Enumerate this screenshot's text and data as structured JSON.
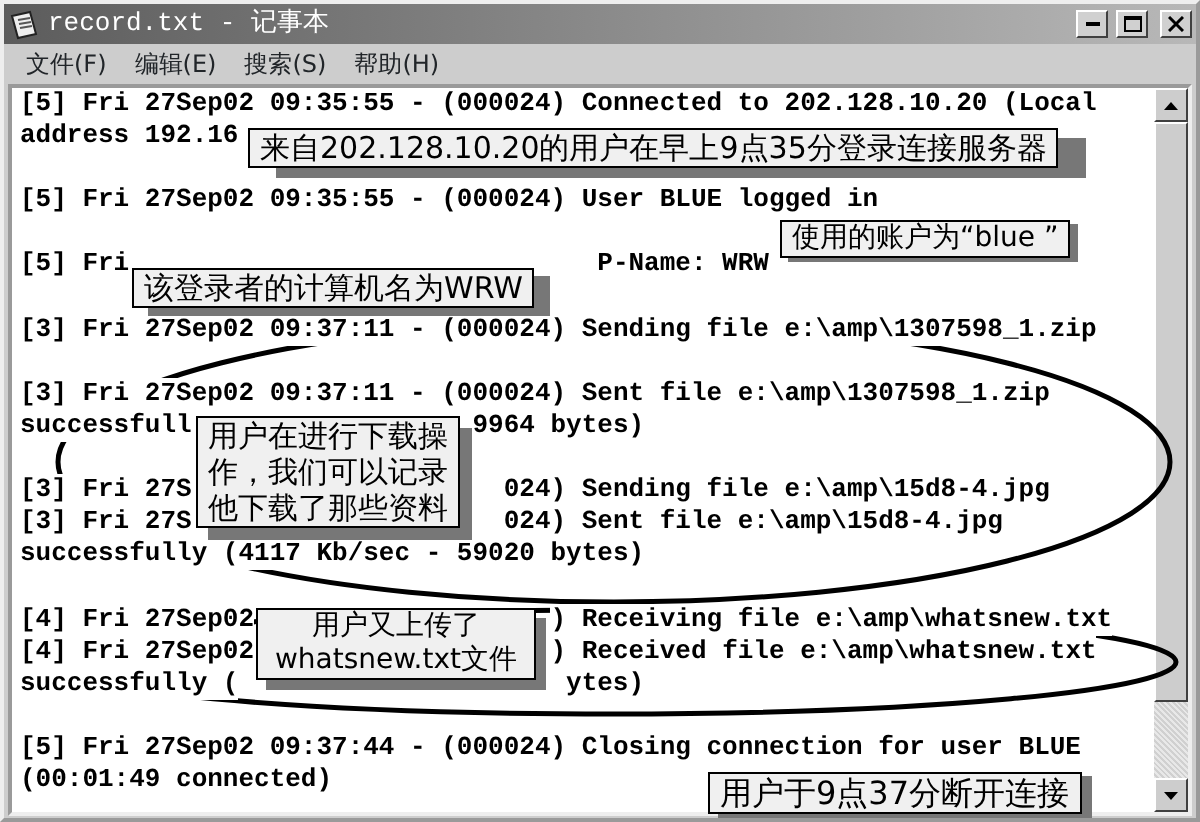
{
  "window": {
    "title": "record.txt - 记事本"
  },
  "menu": [
    "文件(F)",
    "编辑(E)",
    "搜索(S)",
    "帮助(H)"
  ],
  "entries": [
    {
      "lines": [
        {
          "parts": [
            "[5] Fri 27Sep02 09:35:55 - (000024) Connected to 202.128.10.20 (Local"
          ]
        },
        {
          "parts": [
            "address 192.16"
          ]
        }
      ]
    },
    {
      "lines": [
        {
          "parts": [
            "[5] Fri 27Sep02 09:35:55 - (000024) User BLUE logged in"
          ]
        }
      ]
    },
    {
      "lines": [
        {
          "parts": [
            "[5] Fri",
            "P-Name: WRW"
          ]
        }
      ]
    },
    {
      "lines": [
        {
          "parts": [
            "[3] Fri 27Sep02 09:37:11 - (000024) Sending file e:\\amp\\1307598_1.zip"
          ]
        }
      ]
    },
    {
      "lines": [
        {
          "parts": [
            "[3] Fri 27Sep02 09:37:11 - (000024) Sent file e:\\amp\\1307598_1.zip"
          ]
        },
        {
          "parts": [
            "successfull",
            "9964 bytes)"
          ]
        }
      ]
    },
    {
      "lines": [
        {
          "parts": [
            "[3] Fri 27S",
            "024) Sending file e:\\amp\\15d8-4.jpg"
          ]
        },
        {
          "parts": [
            "[3] Fri 27S",
            "024) Sent file e:\\amp\\15d8-4.jpg"
          ]
        },
        {
          "parts": [
            "successfully (4117 Kb/sec - 59020 bytes)"
          ]
        }
      ]
    },
    {
      "lines": [
        {
          "parts": [
            "[4] Fri 27Sep02",
            ") Receiving file e:\\amp\\whatsnew.txt"
          ]
        },
        {
          "parts": [
            "[4] Fri 27Sep02",
            ") Received file e:\\amp\\whatsnew.txt"
          ]
        },
        {
          "parts": [
            "successfully (",
            "ytes)"
          ]
        }
      ]
    },
    {
      "lines": [
        {
          "parts": [
            "[5] Fri 27Sep02 09:37:44 - (000024) Closing connection for user BLUE"
          ]
        },
        {
          "parts": [
            "(00:01:49 connected)"
          ]
        }
      ]
    }
  ],
  "callouts": [
    {
      "text": "来自202.128.10.20的用户在早上9点35分登录连接服务器"
    },
    {
      "text": "使用的账户为“blue ”"
    },
    {
      "text": "该登录者的计算机名为WRW"
    },
    {
      "text": "用户在进行下载操作，我们可以记录他下载了那些资料"
    },
    {
      "text": "用户又上传了whatsnew.txt文件"
    },
    {
      "text": "用户于9点37分断开连接"
    }
  ]
}
